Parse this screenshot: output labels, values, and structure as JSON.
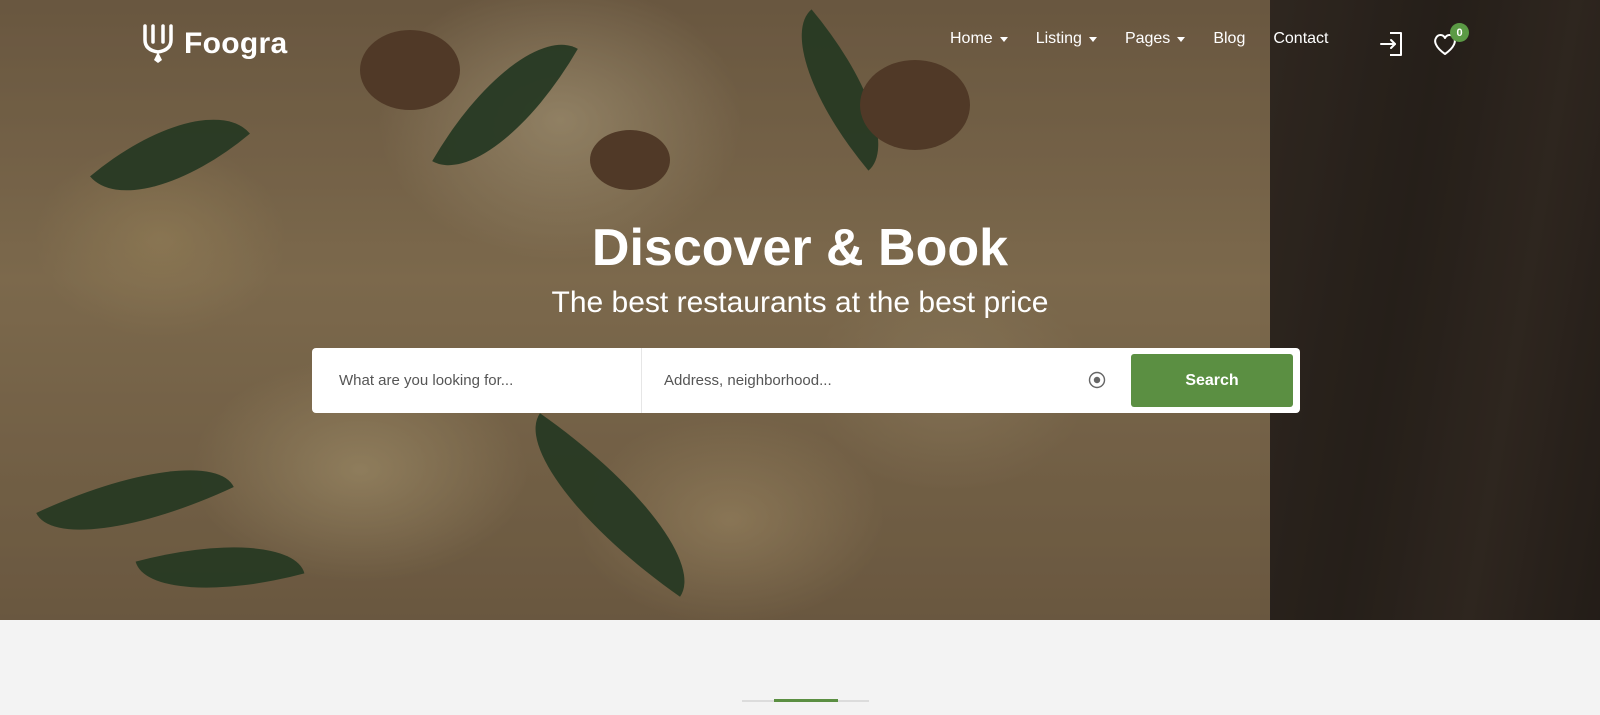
{
  "brand": {
    "name": "Foogra",
    "logo_icon": "fork-icon",
    "accent_color": "#5b8f42"
  },
  "nav": {
    "items": [
      {
        "label": "Home",
        "dropdown": true
      },
      {
        "label": "Listing",
        "dropdown": true
      },
      {
        "label": "Pages",
        "dropdown": true
      },
      {
        "label": "Blog",
        "dropdown": false
      },
      {
        "label": "Contact",
        "dropdown": false
      }
    ],
    "login_icon": "login-icon",
    "wishlist_icon": "heart-icon",
    "wishlist_count": "0"
  },
  "hero": {
    "title": "Discover & Book",
    "subtitle": "The best restaurants at the best price"
  },
  "search": {
    "what_placeholder": "What are you looking for...",
    "address_placeholder": "Address, neighborhood...",
    "locate_icon": "target-icon",
    "button_label": "Search"
  }
}
